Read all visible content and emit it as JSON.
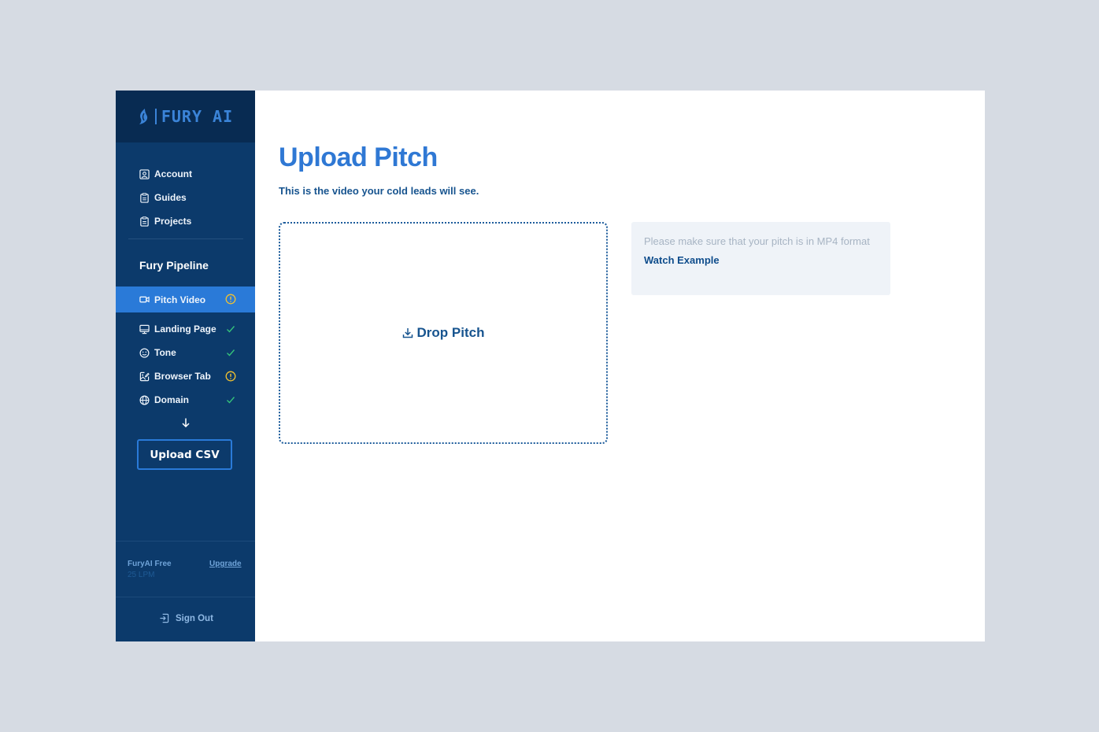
{
  "brand": {
    "logo_text": "FURY AI"
  },
  "nav": [
    {
      "label": "Account",
      "icon": "account-icon"
    },
    {
      "label": "Guides",
      "icon": "clipboard-icon"
    },
    {
      "label": "Projects",
      "icon": "clipboard-icon"
    }
  ],
  "pipeline": {
    "title": "Fury Pipeline",
    "items": [
      {
        "label": "Pitch Video",
        "icon": "video-icon",
        "status": "warning",
        "active": true
      },
      {
        "label": "Landing Page",
        "icon": "monitor-icon",
        "status": "complete"
      },
      {
        "label": "Tone",
        "icon": "smiley-icon",
        "status": "complete"
      },
      {
        "label": "Browser Tab",
        "icon": "image-edit-icon",
        "status": "warning"
      },
      {
        "label": "Domain",
        "icon": "globe-icon",
        "status": "complete"
      }
    ],
    "upload_csv_label": "Upload CSV"
  },
  "plan": {
    "name": "FuryAI Free",
    "limit": "25 LPM",
    "upgrade_label": "Upgrade"
  },
  "sign_out_label": "Sign Out",
  "main": {
    "title": "Upload Pitch",
    "subtitle": "This is the video your cold leads will see.",
    "drop_label": "Drop Pitch",
    "info_text": "Please make sure that your pitch is in MP4 format",
    "watch_example_label": "Watch Example"
  },
  "colors": {
    "sidebar": "#0c3a6b",
    "sidebar_header": "#082b52",
    "accent": "#2a7ad8",
    "title": "#2f78d4",
    "warning": "#f2c230",
    "success": "#35c27a"
  }
}
